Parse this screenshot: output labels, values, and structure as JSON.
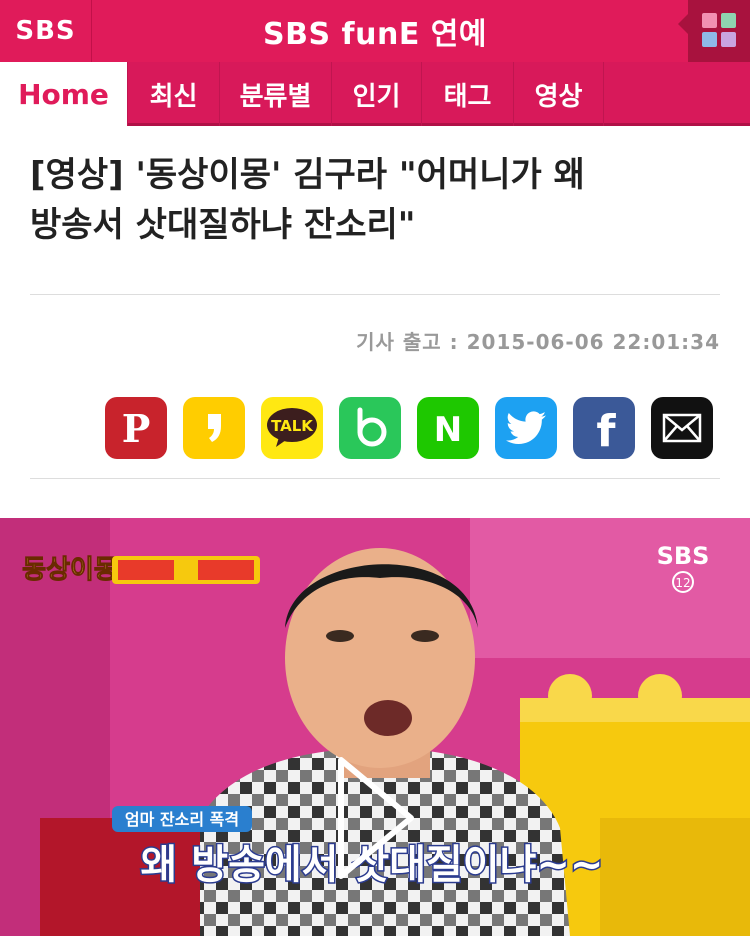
{
  "header": {
    "sbs_logo": "SBS",
    "brand": "SBS funE 연예",
    "menu_icon": "grid-menu-icon"
  },
  "nav": {
    "tabs": [
      {
        "label": "Home",
        "active": true
      },
      {
        "label": "최신"
      },
      {
        "label": "분류별"
      },
      {
        "label": "인기"
      },
      {
        "label": "태그"
      },
      {
        "label": "영상"
      }
    ]
  },
  "article": {
    "headline_line1": "[영상] '동상이몽' 김구라 \"어머니가 왜",
    "headline_line2": "방송서 삿대질하냐 잔소리\"",
    "date_label": "기사 출고 : 2015-06-06 22:01:34"
  },
  "share": {
    "buttons": [
      {
        "name": "pinterest",
        "color": "#c8232c",
        "icon": "pinterest-icon"
      },
      {
        "name": "kakaostory",
        "color": "#ffcd00",
        "icon": "kakaostory-icon"
      },
      {
        "name": "kakaotalk",
        "color": "#ffe812",
        "icon": "kakaotalk-icon",
        "label": "TALK"
      },
      {
        "name": "band",
        "color": "#2ac75a",
        "icon": "band-icon"
      },
      {
        "name": "naver",
        "color": "#1ec800",
        "icon": "naver-icon",
        "label": "N"
      },
      {
        "name": "twitter",
        "color": "#1da1f2",
        "icon": "twitter-icon"
      },
      {
        "name": "facebook",
        "color": "#3b5998",
        "icon": "facebook-icon",
        "label": "f"
      },
      {
        "name": "email",
        "color": "#111111",
        "icon": "email-icon"
      }
    ]
  },
  "video": {
    "channel_logo": "SBS",
    "channel_number": "12",
    "show_logo": "동상이몽",
    "caption_small": "엄마 잔소리 폭격",
    "caption_big": "왜 방송에서 삿대질이냐~~",
    "play_icon": "play-icon"
  },
  "colors": {
    "brand_pink": "#e01b5a",
    "nav_pink": "#d8195a"
  }
}
